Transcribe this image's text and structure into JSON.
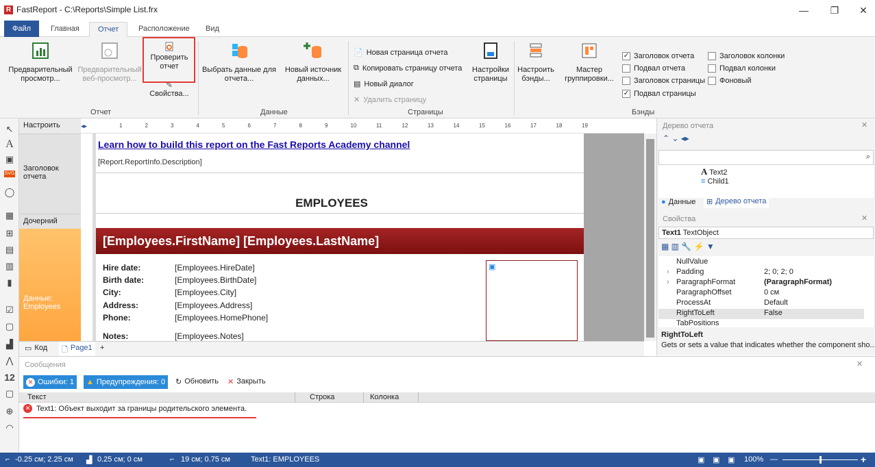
{
  "window": {
    "title": "FastReport - C:\\Reports\\Simple List.frx",
    "minimize": "—",
    "restore": "❐",
    "close": "✕"
  },
  "tabs": [
    "Файл",
    "Главная",
    "Отчет",
    "Расположение",
    "Вид"
  ],
  "ribbon": {
    "preview": "Предварительный просмотр...",
    "web_preview": "Предварительный веб-просмотр...",
    "check_report": "Проверить отчет",
    "properties": "Свойства...",
    "select_data": "Выбрать данные для отчета...",
    "new_source": "Новый источник данных...",
    "new_page": "Новая страница отчета",
    "copy_page": "Копировать страницу отчета",
    "new_dialog": "Новый диалог",
    "delete_page": "Удалить страницу",
    "page_setup": "Настройки страницы",
    "configure_bands": "Настроить бэнды...",
    "group_wizard": "Мастер группировки...",
    "bands_checks": [
      {
        "label": "Заголовок отчета",
        "checked": true
      },
      {
        "label": "Подвал отчета",
        "checked": false
      },
      {
        "label": "Заголовок страницы",
        "checked": false
      },
      {
        "label": "Подвал страницы",
        "checked": true
      },
      {
        "label": "Заголовок колонки",
        "checked": false
      },
      {
        "label": "Подвал колонки",
        "checked": false
      },
      {
        "label": "Фоновый",
        "checked": false
      }
    ],
    "groups": {
      "report": "Отчет",
      "data": "Данные",
      "pages": "Страницы",
      "bands": "Бэнды"
    }
  },
  "bands": {
    "configure": "Настроить",
    "report_title": "Заголовок отчета",
    "child": "Дочерний",
    "data": "Данные: Employees"
  },
  "ruler": [
    "1",
    "2",
    "3",
    "4",
    "5",
    "6",
    "7",
    "8",
    "9",
    "10",
    "11",
    "12",
    "13",
    "14",
    "15",
    "16",
    "17",
    "18",
    "19"
  ],
  "report": {
    "link": "Learn how to build this report on the Fast Reports Academy channel",
    "description": "[Report.ReportInfo.Description]",
    "title": "EMPLOYEES",
    "header": "[Employees.FirstName] [Employees.LastName]",
    "fields": [
      {
        "label": "Hire date:",
        "value": "[Employees.HireDate]"
      },
      {
        "label": "Birth date:",
        "value": "[Employees.BirthDate]"
      },
      {
        "label": "City:",
        "value": "[Employees.City]"
      },
      {
        "label": "Address:",
        "value": "[Employees.Address]"
      },
      {
        "label": "Phone:",
        "value": "[Employees.HomePhone]"
      },
      {
        "label": "Notes:",
        "value": "[Employees.Notes]"
      }
    ]
  },
  "bottom_tabs": {
    "code": "Код",
    "page": "Page1",
    "add": "+"
  },
  "tree_panel": {
    "title": "Дерево отчета",
    "items": [
      "Text2",
      "Child1"
    ],
    "tab_data": "Данные",
    "tab_tree": "Дерево отчета"
  },
  "props_panel": {
    "title": "Свойства",
    "object": "Text1",
    "object_type": "TextObject",
    "rows": [
      {
        "name": "NullValue",
        "value": ""
      },
      {
        "name": "Padding",
        "value": "2; 0; 2; 0"
      },
      {
        "name": "ParagraphFormat",
        "value": "(ParagraphFormat)"
      },
      {
        "name": "ParagraphOffset",
        "value": "0 см"
      },
      {
        "name": "ProcessAt",
        "value": "Default"
      },
      {
        "name": "RightToLeft",
        "value": "False"
      },
      {
        "name": "TabPositions",
        "value": ""
      }
    ],
    "desc_title": "RightToLeft",
    "desc_text": "Gets or sets a value that indicates whether the component sho..."
  },
  "messages": {
    "title": "Сообщения",
    "errors": "Ошибки: 1",
    "warnings": "Предупреждения: 0",
    "refresh": "Обновить",
    "close": "Закрыть",
    "columns": [
      "Текст",
      "Строка",
      "Колонка"
    ],
    "rows": [
      "Text1: Объект выходит за границы родительского элемента."
    ]
  },
  "status": {
    "pos1": "-0.25 см; 2.25 см",
    "pos2": "0.25 см; 0 см",
    "size": "19 см; 0.75 см",
    "obj": "Text1: EMPLOYEES",
    "zoom": "100%"
  }
}
